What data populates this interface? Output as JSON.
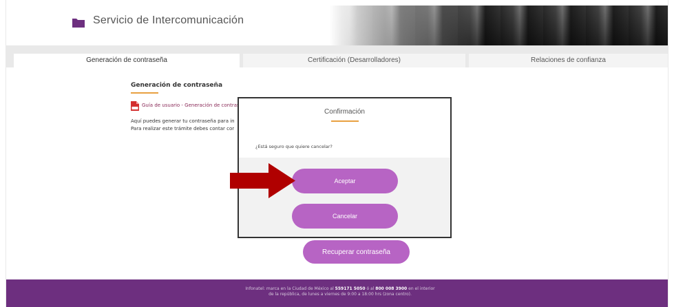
{
  "header": {
    "title": "Servicio de Intercomunicación",
    "icon": "folder-icon"
  },
  "tabs": [
    {
      "label": "Generación de contraseña",
      "active": true
    },
    {
      "label": "Certificación (Desarrolladores)",
      "active": false
    },
    {
      "label": "Relaciones de confianza",
      "active": false
    }
  ],
  "content": {
    "title": "Generación de contraseña",
    "guide_link": "Guía de usuario - Generación de contraseña",
    "text_line1": "Aquí puedes generar tu contraseña para ingresa",
    "text_line2": "Para realizar este trámite debes contar con tu e.",
    "recover_button": "Recuperar contraseña"
  },
  "modal": {
    "title": "Confirmación",
    "question": "¿Está seguro que quiere cancelar?",
    "accept_button": "Aceptar",
    "cancel_button": "Cancelar"
  },
  "footer": {
    "text_prefix": "Infonatel: marca en la Ciudad de México al",
    "phone_cdmx": "559171 5050",
    "text_middle": "ó al",
    "phone_national": "800 008 3900",
    "text_suffix": "en el interior de la república, de lunes a viernes de 9:00 a 18:00 hrs (zona centro)."
  },
  "colors": {
    "accent_purple": "#b764c4",
    "footer_purple": "#6d2f7f",
    "underline_orange": "#e8a040",
    "arrow_red": "#b00000"
  }
}
